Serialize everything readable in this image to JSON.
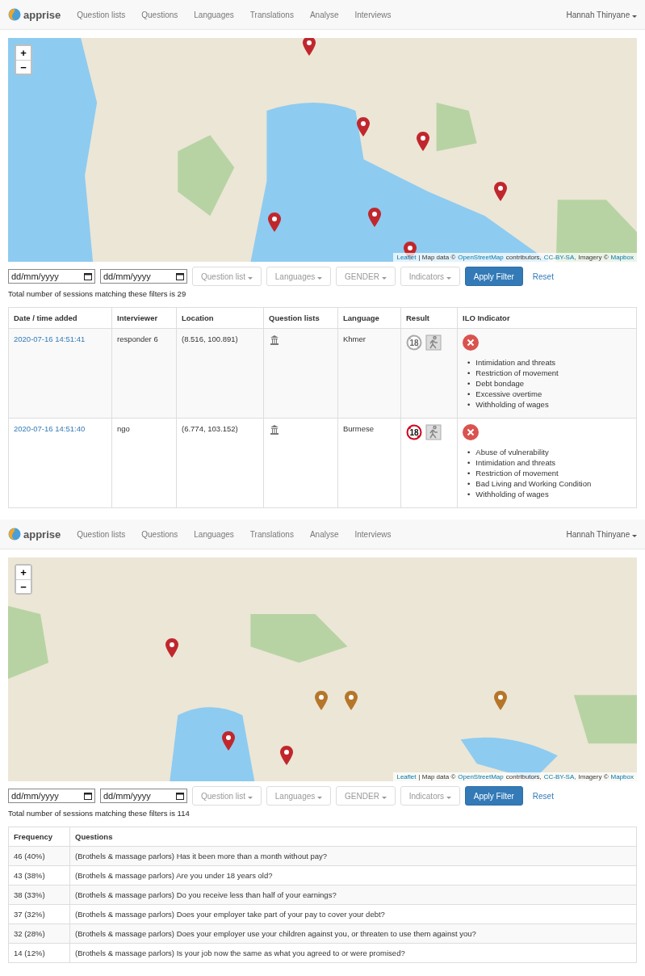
{
  "screens": [
    {
      "navbar": {
        "brand": "apprise",
        "items": [
          "Question lists",
          "Questions",
          "Languages",
          "Translations",
          "Analyse",
          "Interviews"
        ],
        "user": "Hannah Thinyane"
      },
      "map": {
        "zoom_in": "+",
        "zoom_out": "−",
        "attribution": {
          "leaflet": "Leaflet",
          "text1": "| Map data ©",
          "osm": "OpenStreetMap",
          "text2": "contributors,",
          "license": "CC-BY-SA,",
          "text3": "Imagery ©",
          "mapbox": "Mapbox"
        },
        "pins": [
          {
            "color": "#c0272d"
          },
          {
            "color": "#c0272d"
          },
          {
            "color": "#c0272d"
          },
          {
            "color": "#c0272d"
          },
          {
            "color": "#c0272d"
          },
          {
            "color": "#c0272d"
          },
          {
            "color": "#c0272d"
          }
        ]
      },
      "filters": {
        "date_from": "dd/mm/yyyy",
        "date_to": "dd/mm/yyyy",
        "dropdowns": [
          "Question list",
          "Languages",
          "GENDER",
          "Indicators"
        ],
        "apply": "Apply Filter",
        "reset": "Reset"
      },
      "total": "Total number of sessions matching these filters is 29",
      "table": {
        "kind": "sessions",
        "columns": [
          "Date / time added",
          "Interviewer",
          "Location",
          "Question lists",
          "Language",
          "Result",
          "ILO Indicator"
        ],
        "rows": [
          {
            "date": "2020-07-16 14:51:41",
            "interviewer": "responder 6",
            "location": "(8.516, 100.891)",
            "language": "Khmer",
            "age_badge": "18",
            "underage": false,
            "bullet": "•",
            "indicators": [
              "Intimidation and threats",
              "Restriction of movement",
              "Debt bondage",
              "Excessive overtime",
              "Withholding of wages"
            ]
          },
          {
            "date": "2020-07-16 14:51:40",
            "interviewer": "ngo",
            "location": "(6.774, 103.152)",
            "language": "Burmese",
            "age_badge": "18",
            "underage": true,
            "bullet": "•",
            "indicators": [
              "Abuse of vulnerability",
              "Intimidation and threats",
              "Restriction of movement",
              "Bad Living and Working Condition",
              "Withholding of wages"
            ]
          }
        ]
      }
    },
    {
      "navbar": {
        "brand": "apprise",
        "items": [
          "Question lists",
          "Questions",
          "Languages",
          "Translations",
          "Analyse",
          "Interviews"
        ],
        "user": "Hannah Thinyane"
      },
      "map": {
        "zoom_in": "+",
        "zoom_out": "−",
        "attribution": {
          "leaflet": "Leaflet",
          "text1": "| Map data ©",
          "osm": "OpenStreetMap",
          "text2": "contributors,",
          "license": "CC-BY-SA,",
          "text3": "Imagery ©",
          "mapbox": "Mapbox"
        },
        "pins": [
          {
            "color": "#c0272d"
          },
          {
            "color": "#b5762a"
          },
          {
            "color": "#b5762a"
          },
          {
            "color": "#b5762a"
          },
          {
            "color": "#c0272d"
          },
          {
            "color": "#c0272d"
          }
        ]
      },
      "filters": {
        "date_from": "dd/mm/yyyy",
        "date_to": "dd/mm/yyyy",
        "dropdowns": [
          "Question list",
          "Languages",
          "GENDER",
          "Indicators"
        ],
        "apply": "Apply Filter",
        "reset": "Reset"
      },
      "total": "Total number of sessions matching these filters is 114",
      "table": {
        "kind": "frequency",
        "columns": [
          "Frequency",
          "Questions"
        ],
        "rows": [
          {
            "frequency": "46 (40%)",
            "question": "(Brothels & massage parlors) Has it been more than a month without pay?"
          },
          {
            "frequency": "43 (38%)",
            "question": "(Brothels & massage parlors) Are you under 18 years old?"
          },
          {
            "frequency": "38 (33%)",
            "question": "(Brothels & massage parlors) Do you receive less than half of your earnings?"
          },
          {
            "frequency": "37 (32%)",
            "question": "(Brothels & massage parlors) Does your employer take part of your pay to cover your debt?"
          },
          {
            "frequency": "32 (28%)",
            "question": "(Brothels & massage parlors) Does your employer use your children against you, or threaten to use them against you?"
          },
          {
            "frequency": "14 (12%)",
            "question": "(Brothels & massage parlors) Is your job now the same as what you agreed to or were promised?"
          }
        ]
      }
    }
  ]
}
